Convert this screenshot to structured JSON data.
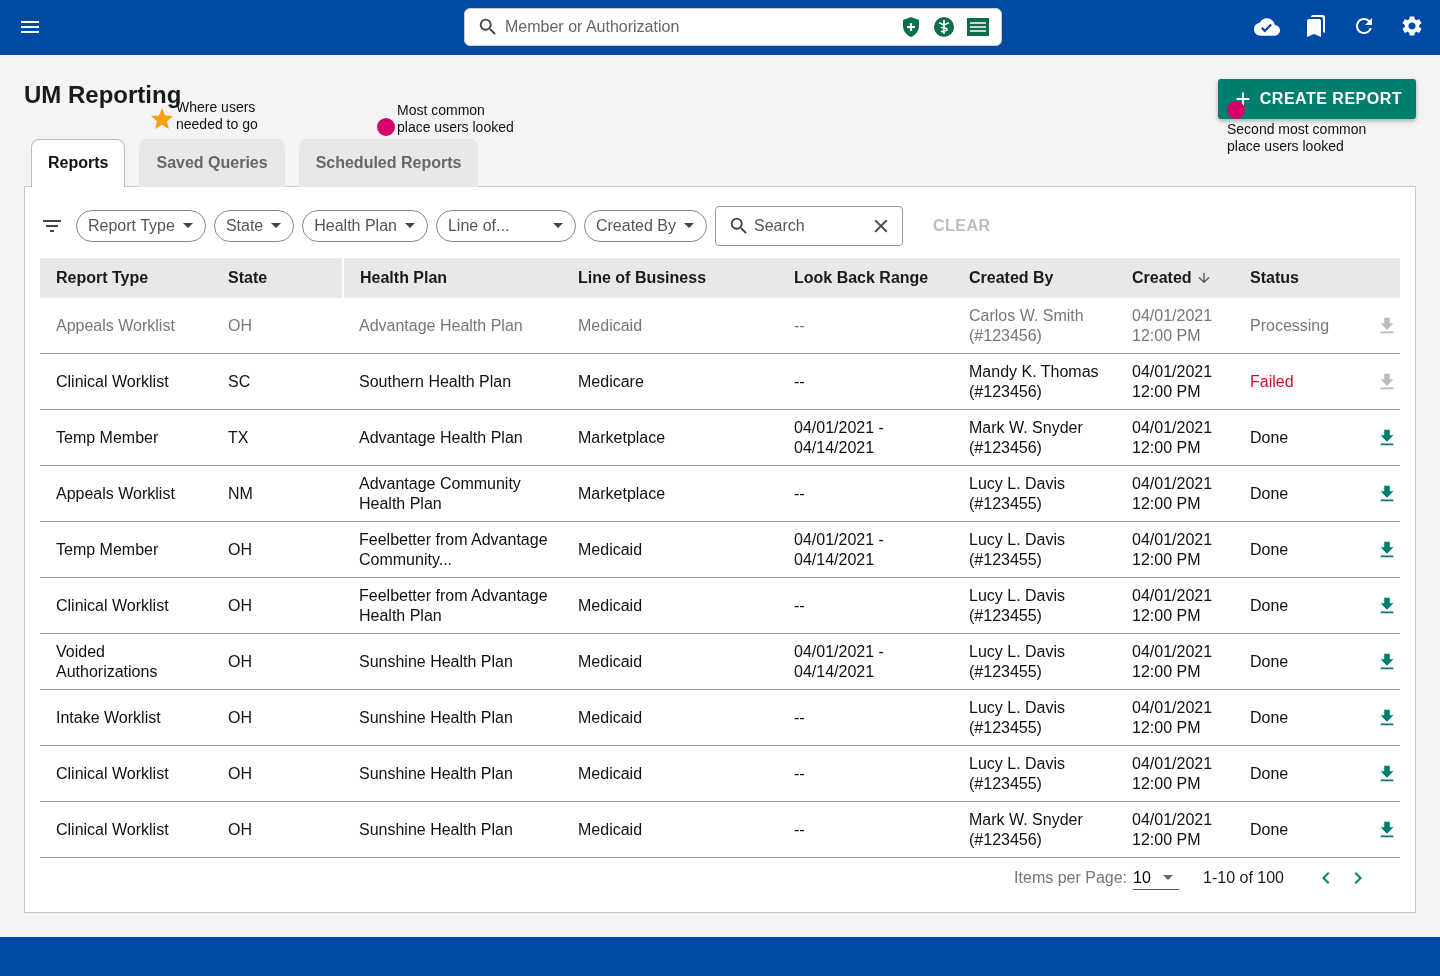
{
  "top_bar": {
    "search": {
      "placeholder": "Member or Authorization"
    }
  },
  "page_title": "UM Reporting",
  "create_button": "CREATE REPORT",
  "tabs": [
    {
      "label": "Reports",
      "selected": true
    },
    {
      "label": "Saved Queries",
      "selected": false
    },
    {
      "label": "Scheduled Reports",
      "selected": false
    }
  ],
  "annotations": [
    {
      "kind": "star",
      "text": "Where users needed to go",
      "color": "#f8a20f"
    },
    {
      "kind": "dot",
      "text": "Most common place users looked",
      "color": "#d6006a"
    },
    {
      "kind": "dot",
      "text": "Second most common place users looked",
      "color": "#d6006a"
    }
  ],
  "filters": [
    "Report Type",
    "State",
    "Health Plan",
    "Line of..."
  ],
  "filter_created_by": "Created By",
  "search": {
    "placeholder": "Search"
  },
  "clear_button": "CLEAR",
  "table": {
    "columns": [
      {
        "label": "Report Type",
        "sorted": false
      },
      {
        "label": "State",
        "sorted": false
      },
      {
        "label": "Health Plan",
        "sorted": false
      },
      {
        "label": "Line of Business",
        "sorted": false
      },
      {
        "label": "Look Back Range",
        "sorted": false
      },
      {
        "label": "Created By",
        "sorted": false
      },
      {
        "label": "Created",
        "sorted": true
      },
      {
        "label": "Status",
        "sorted": false
      }
    ],
    "rows": [
      {
        "kind": "processing",
        "cells": [
          "Appeals Worklist",
          "OH",
          "Advantage Health Plan",
          "Medicaid",
          "--",
          "Carlos W. Smith (#123456)",
          "04/01/2021 12:00 PM",
          "Processing"
        ]
      },
      {
        "kind": "failed",
        "cells": [
          "Clinical Worklist",
          "SC",
          "Southern Health Plan",
          "Medicare",
          "--",
          "Mandy K. Thomas (#123456)",
          "04/01/2021 12:00 PM",
          "Failed"
        ]
      },
      {
        "kind": "done",
        "cells": [
          "Temp Member",
          "TX",
          "Advantage Health Plan",
          "Marketplace",
          "04/01/2021 - 04/14/2021",
          "Mark W. Snyder (#123456)",
          "04/01/2021 12:00 PM",
          "Done"
        ]
      },
      {
        "kind": "done",
        "cells": [
          "Appeals Worklist",
          "NM",
          "Advantage Community Health Plan",
          "Marketplace",
          "--",
          "Lucy L. Davis (#123455)",
          "04/01/2021 12:00 PM",
          "Done"
        ]
      },
      {
        "kind": "done",
        "cells": [
          "Temp Member",
          "OH",
          "Feelbetter from Advantage Community...",
          "Medicaid",
          "04/01/2021 - 04/14/2021",
          "Lucy L. Davis (#123455)",
          "04/01/2021 12:00 PM",
          "Done"
        ]
      },
      {
        "kind": "done",
        "cells": [
          "Clinical Worklist",
          "OH",
          "Feelbetter from Advantage Health Plan",
          "Medicaid",
          "--",
          "Lucy L. Davis (#123455)",
          "04/01/2021 12:00 PM",
          "Done"
        ]
      },
      {
        "kind": "done",
        "cells": [
          "Voided Authorizations",
          "OH",
          "Sunshine Health Plan",
          "Medicaid",
          "04/01/2021 - 04/14/2021",
          "Lucy L. Davis (#123455)",
          "04/01/2021 12:00 PM",
          "Done"
        ]
      },
      {
        "kind": "done",
        "cells": [
          "Intake Worklist",
          "OH",
          "Sunshine Health Plan",
          "Medicaid",
          "--",
          "Lucy L. Davis (#123455)",
          "04/01/2021 12:00 PM",
          "Done"
        ]
      },
      {
        "kind": "done",
        "cells": [
          "Clinical Worklist",
          "OH",
          "Sunshine Health Plan",
          "Medicaid",
          "--",
          "Lucy L. Davis (#123455)",
          "04/01/2021 12:00 PM",
          "Done"
        ]
      },
      {
        "kind": "done",
        "cells": [
          "Clinical Worklist",
          "OH",
          "Sunshine Health Plan",
          "Medicaid",
          "--",
          "Mark W. Snyder (#123456)",
          "04/01/2021 12:00 PM",
          "Done"
        ]
      }
    ]
  },
  "pagination": {
    "label": "Items per Page:",
    "per_page": "10",
    "range": "1-10 of 100"
  }
}
